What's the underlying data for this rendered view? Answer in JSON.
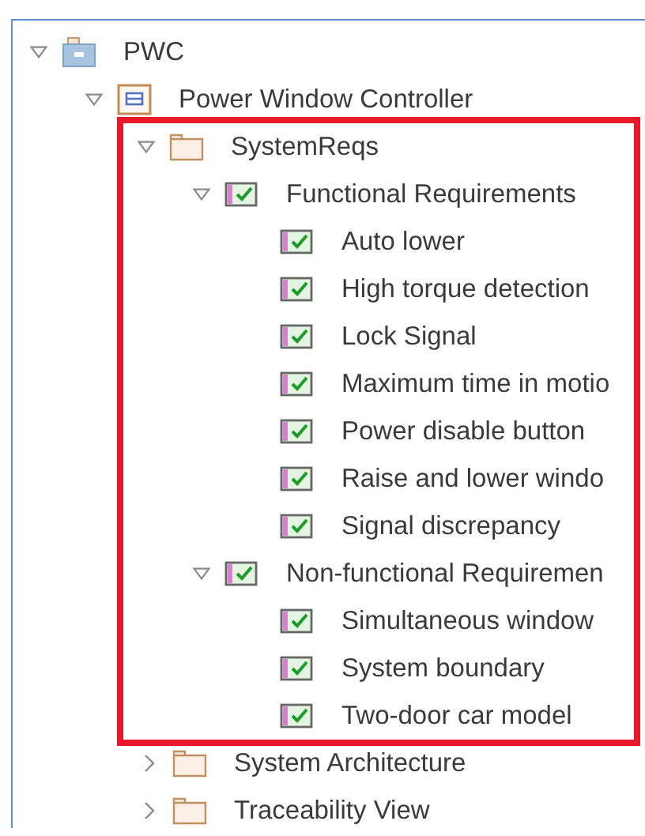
{
  "tree": [
    {
      "label": "PWC",
      "kind": "model",
      "expanded": true,
      "children": [
        {
          "label": "Power Window Controller",
          "kind": "component",
          "expanded": true,
          "children": [
            {
              "label": "SystemReqs",
              "kind": "folder",
              "expanded": true,
              "highlighted": true,
              "children": [
                {
                  "label": "Functional Requirements",
                  "kind": "requirement-set",
                  "expanded": true,
                  "children": [
                    {
                      "label": "Auto lower",
                      "kind": "requirement"
                    },
                    {
                      "label": "High torque detection",
                      "kind": "requirement"
                    },
                    {
                      "label": "Lock Signal",
                      "kind": "requirement"
                    },
                    {
                      "label": "Maximum time in motio",
                      "kind": "requirement"
                    },
                    {
                      "label": "Power disable button",
                      "kind": "requirement"
                    },
                    {
                      "label": "Raise and lower windo",
                      "kind": "requirement"
                    },
                    {
                      "label": "Signal discrepancy",
                      "kind": "requirement"
                    }
                  ]
                },
                {
                  "label": "Non-functional Requiremen",
                  "kind": "requirement-set",
                  "expanded": true,
                  "children": [
                    {
                      "label": "Simultaneous window",
                      "kind": "requirement"
                    },
                    {
                      "label": "System boundary",
                      "kind": "requirement"
                    },
                    {
                      "label": "Two-door car model",
                      "kind": "requirement"
                    }
                  ]
                }
              ]
            },
            {
              "label": "System Architecture",
              "kind": "folder",
              "expanded": false,
              "highlighted": false
            },
            {
              "label": "Traceability View",
              "kind": "folder",
              "expanded": false,
              "highlighted": false
            }
          ]
        }
      ]
    }
  ]
}
